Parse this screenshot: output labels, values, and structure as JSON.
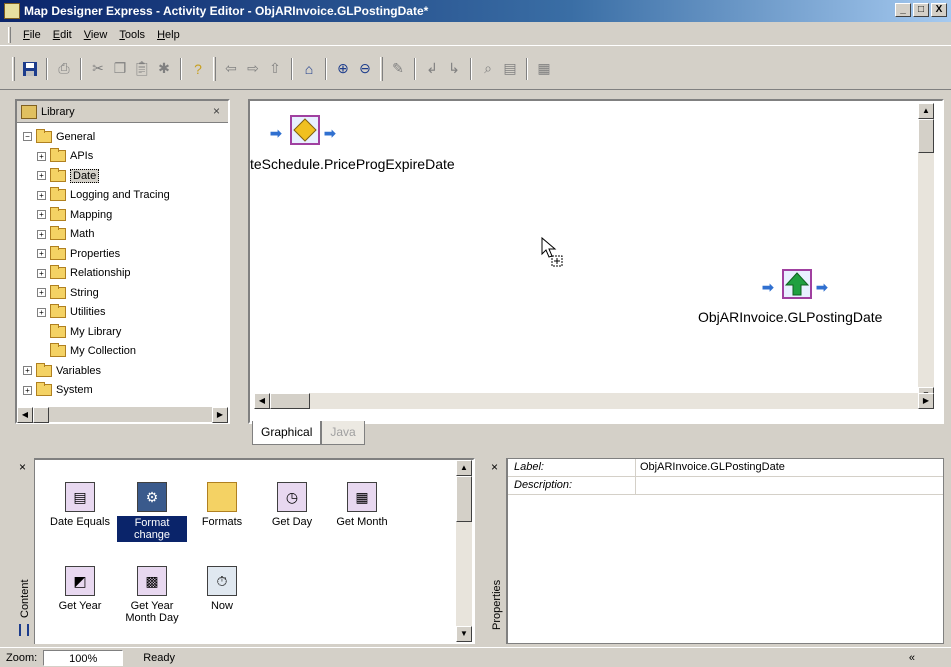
{
  "window": {
    "title": "Map Designer Express - Activity Editor - ObjARInvoice.GLPostingDate*",
    "minimize": "_",
    "maximize": "□",
    "close": "X"
  },
  "menu": {
    "items": [
      "File",
      "Edit",
      "View",
      "Tools",
      "Help"
    ],
    "underlines": [
      "F",
      "E",
      "V",
      "T",
      "H"
    ],
    "rest": [
      "ile",
      "dit",
      "iew",
      "ools",
      "elp"
    ]
  },
  "toolbar": {
    "buttons": [
      "save",
      "print",
      "cut",
      "copy",
      "paste",
      "delete",
      "help",
      "back",
      "forward",
      "up",
      "home",
      "zoom-in",
      "zoom-out",
      "edit",
      "step-into",
      "step-out",
      "find",
      "properties",
      "layout"
    ]
  },
  "library": {
    "title": "Library",
    "close": "×",
    "tree": [
      {
        "label": "General",
        "indent": 0,
        "expander": "−",
        "open": true
      },
      {
        "label": "APIs",
        "indent": 1,
        "expander": "+"
      },
      {
        "label": "Date",
        "indent": 1,
        "expander": "+",
        "open": true,
        "selected": true
      },
      {
        "label": "Logging and Tracing",
        "indent": 1,
        "expander": "+"
      },
      {
        "label": "Mapping",
        "indent": 1,
        "expander": "+"
      },
      {
        "label": "Math",
        "indent": 1,
        "expander": "+"
      },
      {
        "label": "Properties",
        "indent": 1,
        "expander": "+"
      },
      {
        "label": "Relationship",
        "indent": 1,
        "expander": "+"
      },
      {
        "label": "String",
        "indent": 1,
        "expander": "+"
      },
      {
        "label": "Utilities",
        "indent": 1,
        "expander": "+"
      },
      {
        "label": "My Library",
        "indent": 1,
        "expander": ""
      },
      {
        "label": "My Collection",
        "indent": 1,
        "expander": ""
      },
      {
        "label": "Variables",
        "indent": 0,
        "expander": "+"
      },
      {
        "label": "System",
        "indent": 0,
        "expander": "+"
      }
    ]
  },
  "canvas": {
    "node1_label": "teSchedule.PriceProgExpireDate",
    "node2_label": "ObjARInvoice.GLPostingDate"
  },
  "tabs": [
    {
      "label": "Graphical",
      "active": true
    },
    {
      "label": "Java",
      "active": false
    }
  ],
  "content": {
    "side_label": "Content",
    "close": "×",
    "items": [
      {
        "label": "Date Equals",
        "icon": "date-equals-icon"
      },
      {
        "label": "Format change",
        "icon": "format-change-icon",
        "selected": true
      },
      {
        "label": "Formats",
        "icon": "folder-icon"
      },
      {
        "label": "Get Day",
        "icon": "get-day-icon"
      },
      {
        "label": "Get Month",
        "icon": "get-month-icon"
      },
      {
        "label": "Get Year",
        "icon": "get-year-icon"
      },
      {
        "label": "Get Year Month Day",
        "icon": "get-ymd-icon"
      },
      {
        "label": "Now",
        "icon": "clock-icon"
      }
    ]
  },
  "properties": {
    "side_label": "Properties",
    "close": "×",
    "rows": [
      {
        "key": "Label:",
        "value": "ObjARInvoice.GLPostingDate"
      },
      {
        "key": "Description:",
        "value": ""
      }
    ]
  },
  "status": {
    "zoom_label": "Zoom:",
    "zoom_value": "100%",
    "state": "Ready",
    "collapse": "«"
  }
}
